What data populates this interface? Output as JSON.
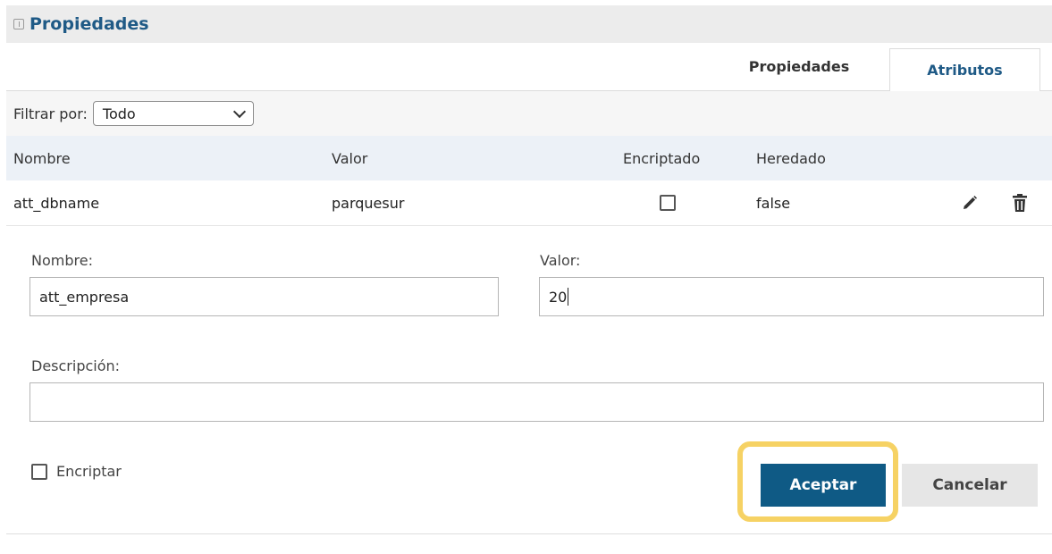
{
  "panel": {
    "title": "Propiedades",
    "collapse_icon": "collapse-icon"
  },
  "tabs": [
    {
      "label": "Propiedades",
      "active": false
    },
    {
      "label": "Atributos",
      "active": true
    }
  ],
  "filter": {
    "label": "Filtrar por:",
    "selected": "Todo"
  },
  "table": {
    "columns": [
      "Nombre",
      "Valor",
      "Encriptado",
      "Heredado"
    ],
    "rows": [
      {
        "nombre": "att_dbname",
        "valor": "parquesur",
        "encriptado": false,
        "heredado": "false",
        "actions": [
          "pencil-icon",
          "trash-icon"
        ]
      }
    ]
  },
  "form": {
    "nombre_label": "Nombre:",
    "nombre_value": "att_empresa",
    "valor_label": "Valor:",
    "valor_value": "20",
    "descripcion_label": "Descripción:",
    "descripcion_value": "",
    "encriptar_label": "Encriptar",
    "encriptar_checked": false,
    "accept_label": "Aceptar",
    "cancel_label": "Cancelar"
  },
  "colors": {
    "accent": "#1f5a86",
    "accept_bg": "#0f5a85",
    "highlight": "#f6d264"
  }
}
